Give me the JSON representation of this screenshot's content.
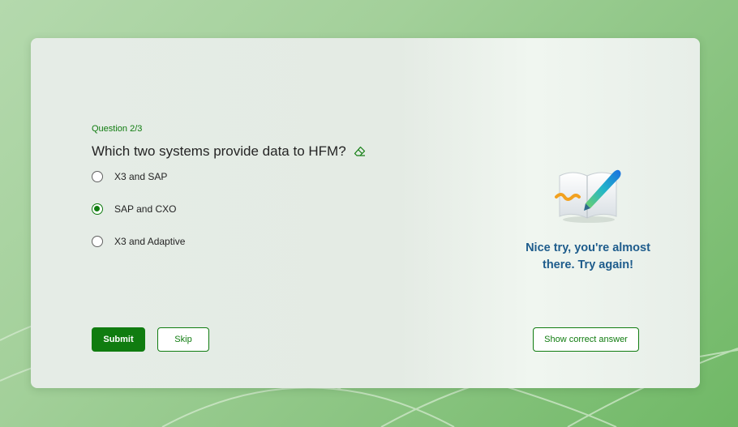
{
  "quiz": {
    "question_number": "Question 2/3",
    "question_text": "Which two systems provide data to HFM?",
    "options": [
      {
        "label": "X3 and SAP",
        "selected": false
      },
      {
        "label": "SAP and CXO",
        "selected": true
      },
      {
        "label": "X3 and Adaptive",
        "selected": false
      }
    ],
    "feedback": "Nice try, you're almost there. Try again!"
  },
  "actions": {
    "submit_label": "Submit",
    "skip_label": "Skip",
    "show_answer_label": "Show correct answer"
  },
  "colors": {
    "accent": "#107c10",
    "feedback_text": "#1e5c8c"
  },
  "icons": {
    "title_icon": "eraser-icon",
    "illustration": "book-pen-icon"
  }
}
